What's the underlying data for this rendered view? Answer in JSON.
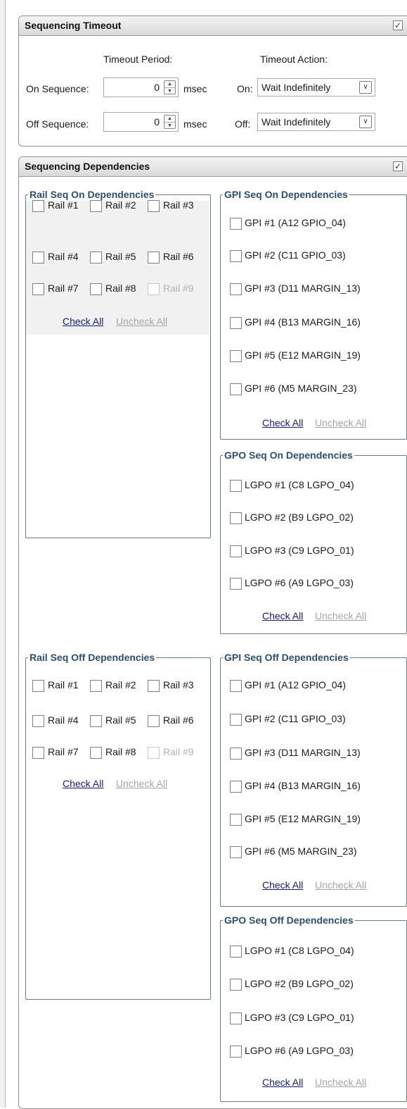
{
  "timeout": {
    "title": "Sequencing Timeout",
    "period_header": "Timeout Period:",
    "action_header": "Timeout Action:",
    "on_label": "On Sequence:",
    "off_label": "Off Sequence:",
    "on_value": "0",
    "off_value": "0",
    "unit": "msec",
    "on_action_label": "On:",
    "off_action_label": "Off:",
    "on_action": "Wait Indefinitely",
    "off_action": "Wait Indefinitely",
    "enabled_check": "✓"
  },
  "dependencies": {
    "title": "Sequencing Dependencies",
    "enabled_check": "✓",
    "rail_on": {
      "title": "Rail Seq On Dependencies",
      "items": [
        "Rail #1",
        "Rail #2",
        "Rail #3",
        "Rail #4",
        "Rail #5",
        "Rail #6",
        "Rail #7",
        "Rail #8",
        "Rail #9"
      ]
    },
    "rail_off": {
      "title": "Rail Seq Off Dependencies",
      "items": [
        "Rail #1",
        "Rail #2",
        "Rail #3",
        "Rail #4",
        "Rail #5",
        "Rail #6",
        "Rail #7",
        "Rail #8",
        "Rail #9"
      ]
    },
    "gpi_on": {
      "title": "GPI Seq On Dependencies",
      "items": [
        "GPI #1 (A12 GPIO_04)",
        "GPI #2 (C11 GPIO_03)",
        "GPI #3 (D11 MARGIN_13)",
        "GPI #4 (B13 MARGIN_16)",
        "GPI #5 (E12 MARGIN_19)",
        "GPI #6 (M5 MARGIN_23)"
      ]
    },
    "gpi_off": {
      "title": "GPI Seq Off Dependencies",
      "items": [
        "GPI #1 (A12 GPIO_04)",
        "GPI #2 (C11 GPIO_03)",
        "GPI #3 (D11 MARGIN_13)",
        "GPI #4 (B13 MARGIN_16)",
        "GPI #5 (E12 MARGIN_19)",
        "GPI #6 (M5 MARGIN_23)"
      ]
    },
    "gpo_on": {
      "title": "GPO Seq On Dependencies",
      "items": [
        "LGPO #1 (C8 LGPO_04)",
        "LGPO #2 (B9 LGPO_02)",
        "LGPO #3 (C9 LGPO_01)",
        "LGPO #6 (A9 LGPO_03)"
      ]
    },
    "gpo_off": {
      "title": "GPO Seq Off Dependencies",
      "items": [
        "LGPO #1 (C8 LGPO_04)",
        "LGPO #2 (B9 LGPO_02)",
        "LGPO #3 (C9 LGPO_01)",
        "LGPO #6 (A9 LGPO_03)"
      ]
    },
    "check_all": "Check All",
    "uncheck_all": "Uncheck All"
  },
  "icons": {
    "spin_up": "▲",
    "spin_down": "▼",
    "dropdown": "∨"
  }
}
